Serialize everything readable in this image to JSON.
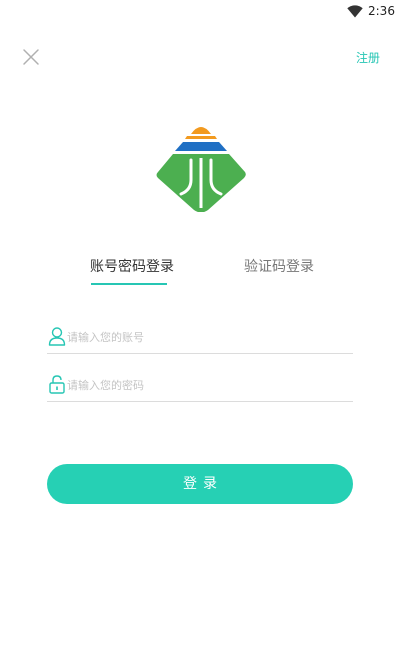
{
  "status_bar": {
    "time": "2:36",
    "wifi_icon": "wifi-icon"
  },
  "header": {
    "close_icon": "close-icon",
    "register_label": "注册"
  },
  "logo": {
    "icon": "app-logo",
    "colors": {
      "orange": "#f29a1f",
      "blue": "#1f6fc4",
      "green": "#4caf50"
    }
  },
  "tabs": [
    {
      "label": "账号密码登录",
      "active": true
    },
    {
      "label": "验证码登录",
      "active": false
    }
  ],
  "form": {
    "account": {
      "placeholder": "请输入您的账号",
      "value": "",
      "icon": "user-icon"
    },
    "password": {
      "placeholder": "请输入您的密码",
      "value": "",
      "icon": "lock-icon"
    }
  },
  "login_button": {
    "label": "登录"
  },
  "colors": {
    "accent": "#26c6b4",
    "button": "#26d0b4"
  }
}
